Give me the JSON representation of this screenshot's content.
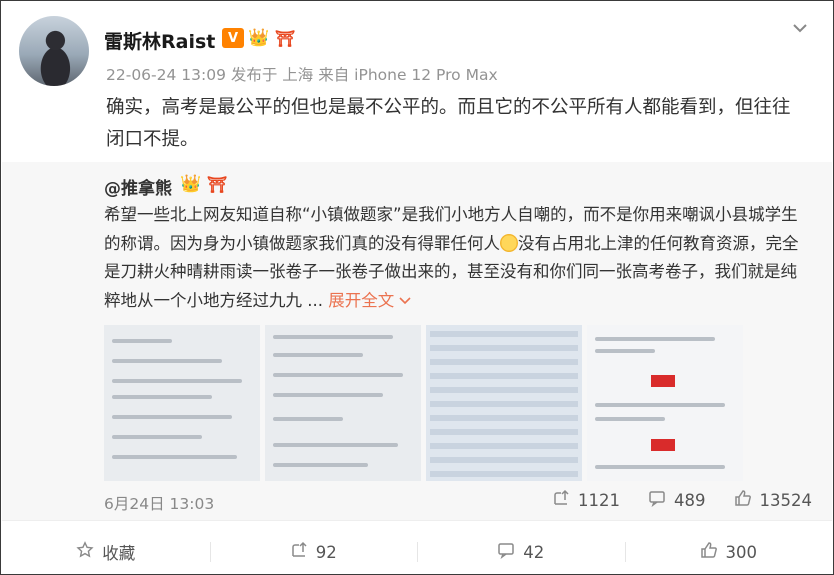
{
  "post": {
    "username": "雷斯林Raist",
    "badges": [
      "V",
      "👑",
      "⛩"
    ],
    "meta": "22-06-24 13:09 发布于 上海 来自 iPhone 12 Pro Max",
    "text": "确实，高考是最公平的但也是最不公平的。而且它的不公平所有人都能看到，但往往闭口不提。"
  },
  "repost": {
    "author": "@推拿熊",
    "badges": [
      "👑",
      "⛩"
    ],
    "text_before_emoji": "希望一些北上网友知道自称“小镇做题家”是我们小地方人自嘲的，而不是你用来嘲讽小县城学生的称谓。因为身为小镇做题家我们真的没有得罪任何人",
    "text_after_emoji": "没有占用北上津的任何教育资源，完全是刀耕火种晴耕雨读一张卷子一张卷子做出来的，甚至没有和你们同一张高考卷子，我们就是纯粹地从一个小地方经过九九 ...",
    "expand_label": "展开全文",
    "time": "6月24日 13:03",
    "stats": {
      "reposts": "1121",
      "comments": "489",
      "likes": "13524"
    }
  },
  "actions": {
    "favorite": "收藏",
    "repost": "92",
    "comment": "42",
    "like": "300"
  },
  "icons": {
    "more": "chevron-down-icon",
    "repost": "repost-icon",
    "comment": "comment-icon",
    "like": "like-icon",
    "favorite": "star-icon"
  },
  "colors": {
    "accent": "#eb7350",
    "vip_badge": "#ff8200",
    "repost_bg": "#f7f7f7",
    "meta_text": "#939393"
  }
}
